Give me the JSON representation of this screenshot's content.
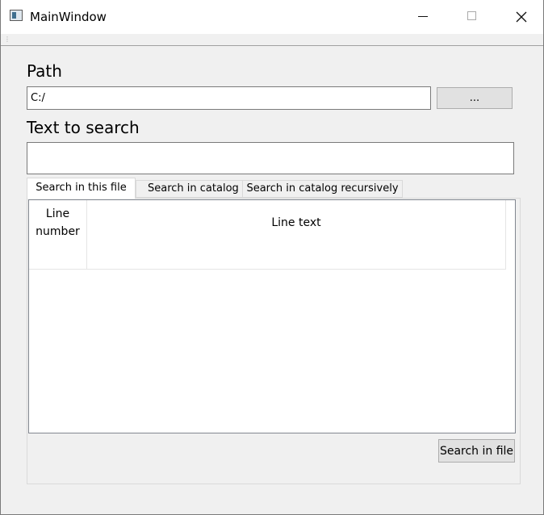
{
  "window": {
    "title": "MainWindow",
    "icon": "app-window-icon"
  },
  "controls": {
    "minimize_icon": "minimize-icon",
    "maximize_icon": "maximize-icon",
    "close_icon": "close-icon"
  },
  "toolbar": {
    "grip": "⋮"
  },
  "path": {
    "label": "Path",
    "value": "C:/",
    "browse_label": "..."
  },
  "search_text": {
    "label": "Text to search",
    "value": ""
  },
  "tabs": [
    {
      "label": "Search in this file",
      "active": true
    },
    {
      "label": "Search in catalog",
      "active": false
    },
    {
      "label": "Search in catalog recursively",
      "active": false
    }
  ],
  "table": {
    "columns": [
      {
        "label": "Line number"
      },
      {
        "label": "Line text"
      }
    ],
    "rows": []
  },
  "actions": {
    "search_in_file_label": "Search in file"
  },
  "colors": {
    "background": "#f0f0f0",
    "titlebar": "#ffffff",
    "button_face": "#e1e1e1",
    "button_border": "#adadad"
  }
}
